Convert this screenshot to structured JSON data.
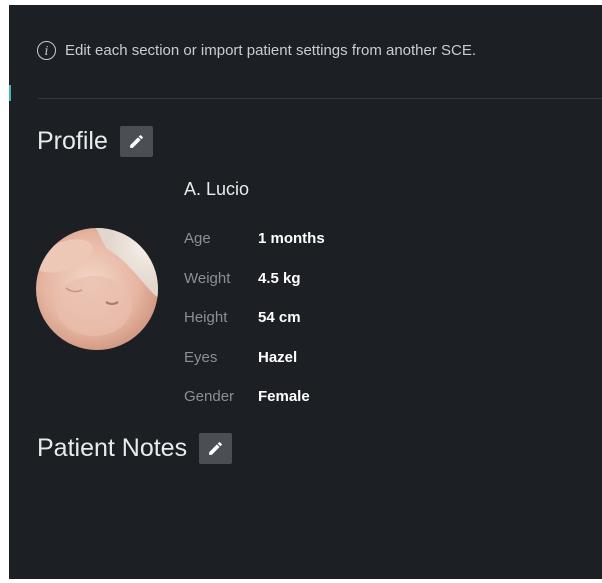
{
  "info": {
    "icon": "info-icon",
    "glyph": "i",
    "text": "Edit each section or import patient settings from another SCE."
  },
  "profile": {
    "title": "Profile",
    "edit_icon": "pencil-icon",
    "name": "A. Lucio",
    "fields": [
      {
        "label": "Age",
        "value": "1 months"
      },
      {
        "label": "Weight",
        "value": "4.5 kg"
      },
      {
        "label": "Height",
        "value": "54 cm"
      },
      {
        "label": "Eyes",
        "value": "Hazel"
      },
      {
        "label": "Gender",
        "value": "Female"
      }
    ]
  },
  "notes": {
    "title": "Patient Notes",
    "edit_icon": "pencil-icon"
  },
  "colors": {
    "background": "#1c2024",
    "accent": "#3fb6b6",
    "edit_button": "#4a4f55",
    "label": "#8a9096",
    "value": "#ffffff"
  }
}
